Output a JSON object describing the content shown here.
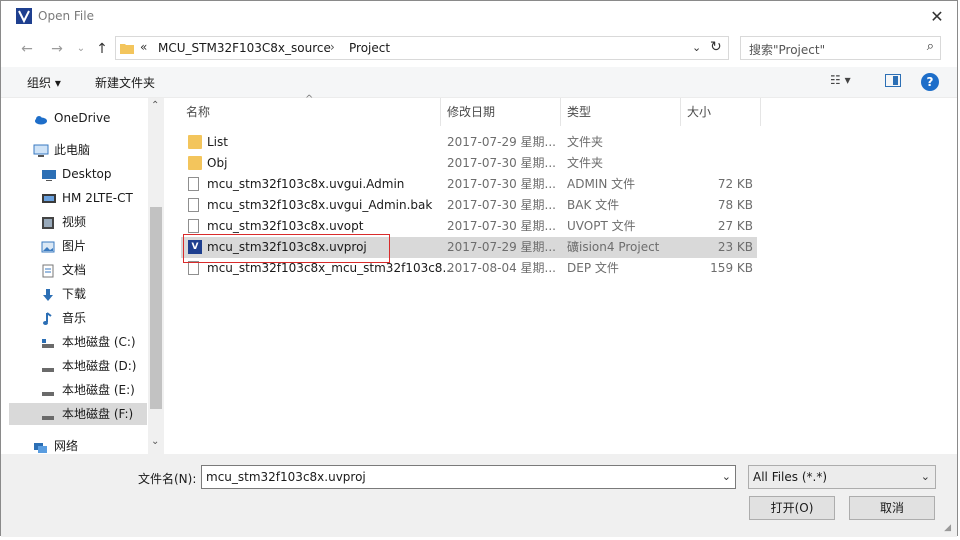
{
  "window": {
    "title": "Open File",
    "close_glyph": "✕"
  },
  "nav": {
    "back": "←",
    "forward": "→",
    "recent": "⌄",
    "up": "↑"
  },
  "address": {
    "overflow": "«",
    "crumbs": [
      "MCU_STM32F103C8x_source",
      "Project"
    ],
    "separator": "›",
    "dropdown": "⌄",
    "refresh": "↻"
  },
  "search": {
    "placeholder": "搜索\"Project\"",
    "icon": "⌕"
  },
  "toolbar": {
    "organize": "组织 ▾",
    "new_folder": "新建文件夹",
    "view": "☷ ▾",
    "help": "?"
  },
  "sidebar": {
    "items": [
      {
        "label": "OneDrive",
        "icon": "cloud-icon"
      },
      {
        "label": "此电脑",
        "icon": "computer-icon"
      },
      {
        "label": "Desktop",
        "icon": "desktop-icon"
      },
      {
        "label": "HM 2LTE-CT",
        "icon": "device-icon"
      },
      {
        "label": "视频",
        "icon": "video-icon"
      },
      {
        "label": "图片",
        "icon": "picture-icon"
      },
      {
        "label": "文档",
        "icon": "document-icon"
      },
      {
        "label": "下载",
        "icon": "download-icon"
      },
      {
        "label": "音乐",
        "icon": "music-icon"
      },
      {
        "label": "本地磁盘 (C:)",
        "icon": "drive-icon"
      },
      {
        "label": "本地磁盘 (D:)",
        "icon": "drive-icon"
      },
      {
        "label": "本地磁盘 (E:)",
        "icon": "drive-icon"
      },
      {
        "label": "本地磁盘 (F:)",
        "icon": "drive-icon",
        "selected": true
      },
      {
        "label": "网络",
        "icon": "network-icon"
      }
    ]
  },
  "columns": {
    "name": "名称",
    "date": "修改日期",
    "type": "类型",
    "size": "大小"
  },
  "files": [
    {
      "name": "List",
      "date": "2017-07-29 星期...",
      "type": "文件夹",
      "size": "",
      "icon": "folder-icon"
    },
    {
      "name": "Obj",
      "date": "2017-07-30 星期...",
      "type": "文件夹",
      "size": "",
      "icon": "folder-icon"
    },
    {
      "name": "mcu_stm32f103c8x.uvgui.Admin",
      "date": "2017-07-30 星期...",
      "type": "ADMIN 文件",
      "size": "72 KB",
      "icon": "file-icon"
    },
    {
      "name": "mcu_stm32f103c8x.uvgui_Admin.bak",
      "date": "2017-07-30 星期...",
      "type": "BAK 文件",
      "size": "78 KB",
      "icon": "file-icon"
    },
    {
      "name": "mcu_stm32f103c8x.uvopt",
      "date": "2017-07-30 星期...",
      "type": "UVOPT 文件",
      "size": "27 KB",
      "icon": "file-icon"
    },
    {
      "name": "mcu_stm32f103c8x.uvproj",
      "date": "2017-07-29 星期...",
      "type": "礦ision4 Project",
      "size": "23 KB",
      "icon": "keil-project-icon",
      "selected": true
    },
    {
      "name": "mcu_stm32f103c8x_mcu_stm32f103c8...",
      "date": "2017-08-04 星期...",
      "type": "DEP 文件",
      "size": "159 KB",
      "icon": "file-icon"
    }
  ],
  "bottom": {
    "filename_label": "文件名(N):",
    "filename_value": "mcu_stm32f103c8x.uvproj",
    "filetype_value": "All Files (*.*)",
    "open_button": "打开(O)",
    "cancel_button": "取消"
  },
  "colors": {
    "accent": "#1e6ec9",
    "selection": "#d9d9d9",
    "highlight_box": "#d92b2b",
    "folder": "#f3c55c"
  }
}
